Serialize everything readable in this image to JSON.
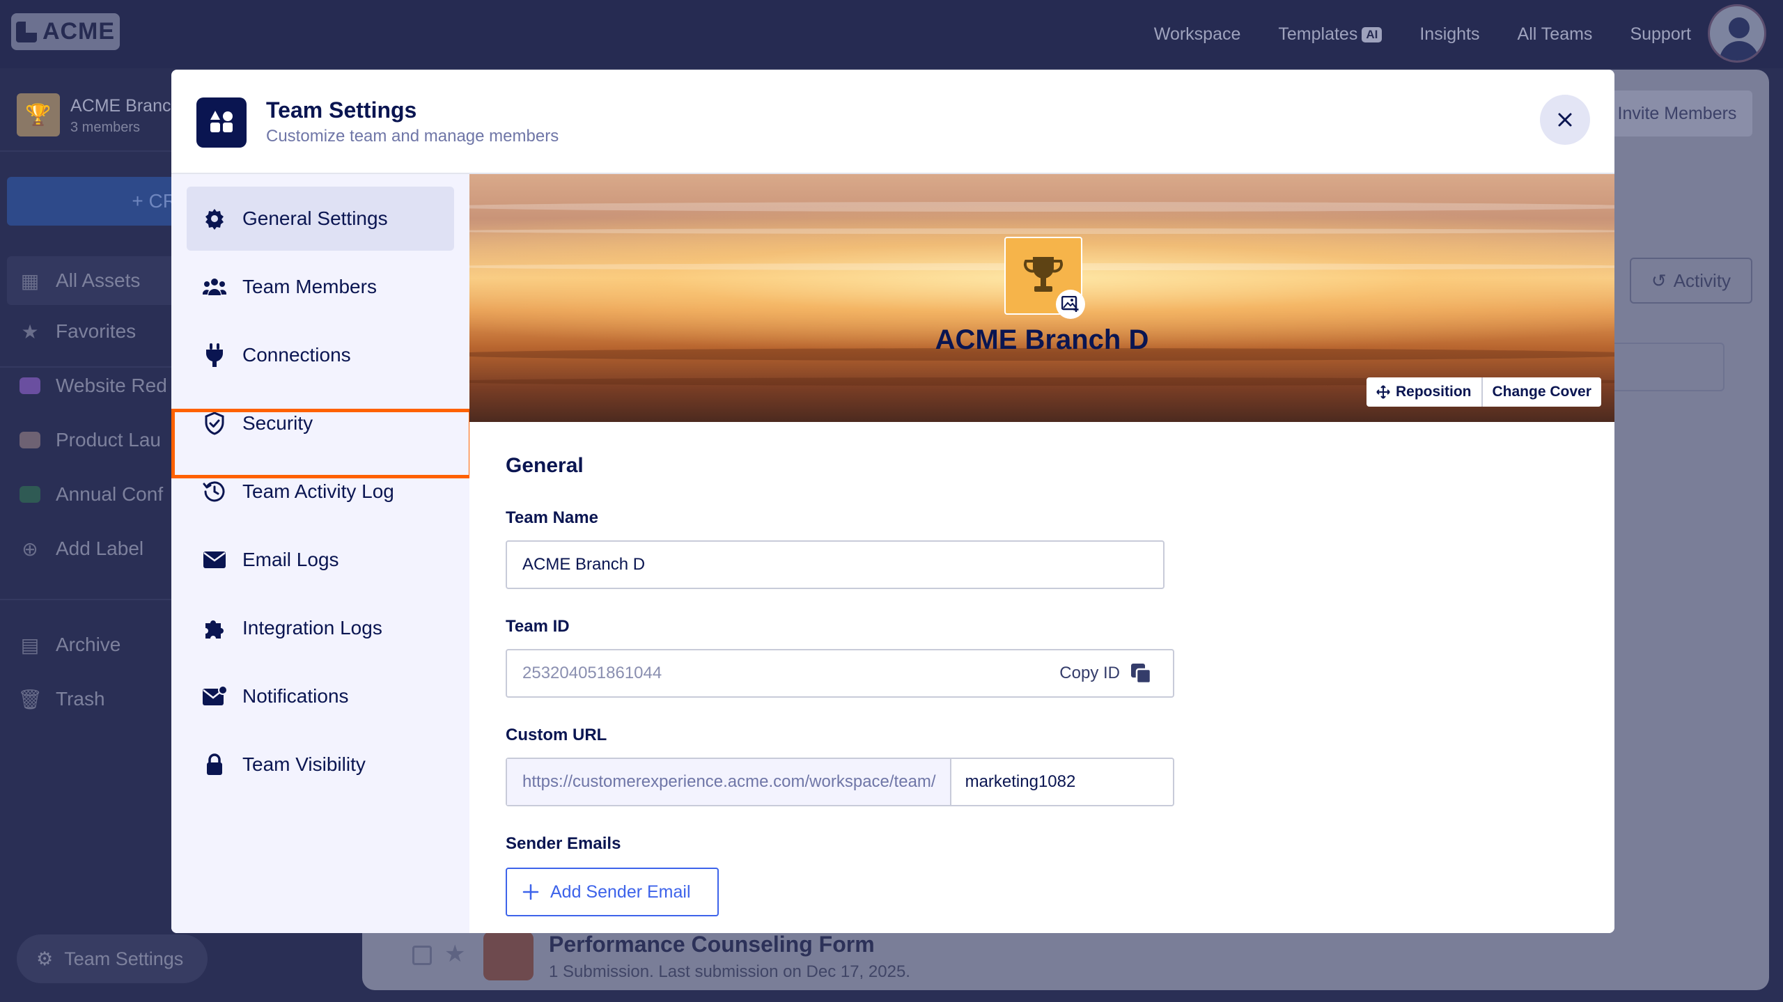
{
  "app": {
    "logo_text": "ACME",
    "nav": [
      "Workspace",
      "Templates",
      "Insights",
      "All Teams",
      "Support"
    ],
    "templates_badge": "AI"
  },
  "sidebar": {
    "team_name": "ACME Branc",
    "team_members": "3 members",
    "create_label": "+ CR",
    "items": [
      {
        "label": "All Assets",
        "icon": "grid-icon"
      },
      {
        "label": "Favorites",
        "icon": "star-icon"
      },
      {
        "label": "Website Red",
        "icon": "tag-icon",
        "color": "#6a4fa0"
      },
      {
        "label": "Product Lau",
        "icon": "tag-icon",
        "color": "#6e6273"
      },
      {
        "label": "Annual Conf",
        "icon": "tag-icon",
        "color": "#2f5a54"
      },
      {
        "label": "Add Label",
        "icon": "plus-circle-icon"
      },
      {
        "label": "Archive",
        "icon": "archive-icon"
      },
      {
        "label": "Trash",
        "icon": "trash-icon"
      }
    ],
    "team_settings_label": "Team Settings"
  },
  "background": {
    "invite_label": "Invite Members",
    "activity_label": "Activity",
    "form_title": "Performance Counseling Form",
    "form_subtitle": "1 Submission.  Last submission on Dec 17, 2025."
  },
  "modal": {
    "title": "Team Settings",
    "subtitle": "Customize team and manage members",
    "menu": [
      {
        "label": "General Settings",
        "icon": "gear-icon",
        "active": true
      },
      {
        "label": "Team Members",
        "icon": "users-icon",
        "active": false
      },
      {
        "label": "Connections",
        "icon": "plug-icon",
        "active": false
      },
      {
        "label": "Security",
        "icon": "shield-check-icon",
        "active": false,
        "highlighted": true
      },
      {
        "label": "Team Activity Log",
        "icon": "history-icon",
        "active": false
      },
      {
        "label": "Email Logs",
        "icon": "envelope-icon",
        "active": false
      },
      {
        "label": "Integration Logs",
        "icon": "puzzle-icon",
        "active": false
      },
      {
        "label": "Notifications",
        "icon": "mail-notification-icon",
        "active": false
      },
      {
        "label": "Team Visibility",
        "icon": "lock-icon",
        "active": false
      }
    ],
    "cover": {
      "team_name": "ACME Branch D",
      "reposition_label": "Reposition",
      "change_cover_label": "Change Cover"
    },
    "general": {
      "section_title": "General",
      "team_name_label": "Team Name",
      "team_name_value": "ACME Branch D",
      "team_id_label": "Team ID",
      "team_id_value": "253204051861044",
      "copy_id_label": "Copy ID",
      "custom_url_label": "Custom URL",
      "custom_url_prefix": "https://customerexperience.acme.com/workspace/team/",
      "custom_url_slug": "marketing1082",
      "sender_emails_label": "Sender Emails",
      "add_sender_label": "Add Sender Email"
    }
  },
  "colors": {
    "navy": "#0a1551",
    "accent_blue": "#3d63ea",
    "highlight_orange": "#ff6100",
    "menu_bg": "#f3f3fe",
    "active_menu": "#dfe1f4"
  }
}
